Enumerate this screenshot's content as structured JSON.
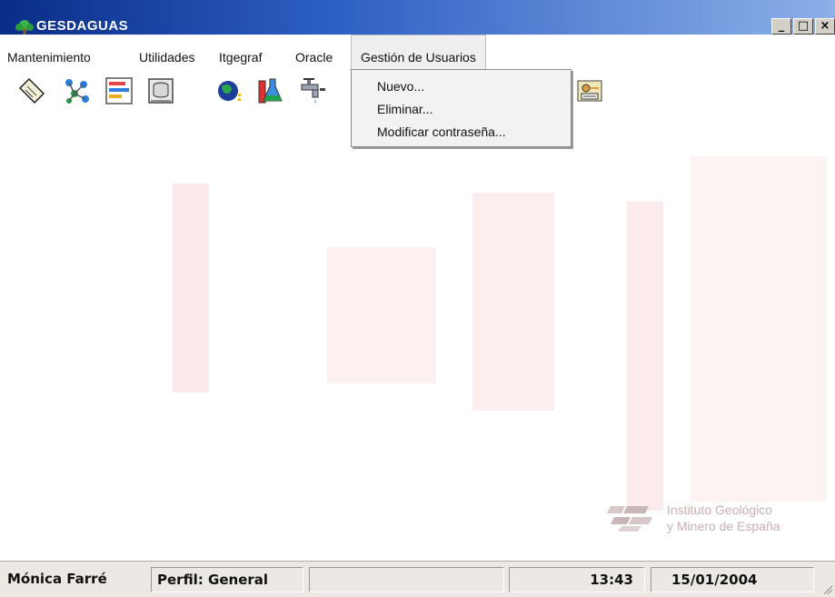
{
  "window": {
    "title": "GESDAGUAS",
    "icon": "app-tree-icon",
    "controls": [
      "_",
      "□",
      "×"
    ]
  },
  "menu": {
    "items": [
      "Mantenimiento",
      "Utilidades",
      "Itgegraf",
      "Oracle",
      "Gestión de Usuarios"
    ],
    "open_menu": "Gestión de Usuarios",
    "dropdown": [
      "Nuevo...",
      "Eliminar...",
      "Modificar contraseña..."
    ]
  },
  "toolbar": {
    "icons": [
      "document-icon",
      "network-icon",
      "chart-icon",
      "database-icon",
      "globe-icon",
      "lab-flask-icon",
      "water-tap-icon",
      "user-keys-icon"
    ]
  },
  "logo": {
    "line1": "Instituto Geológico",
    "line2": "y Minero de España"
  },
  "status": {
    "user": "Mónica Farré",
    "profile": "Perfil: General",
    "time": "13:43",
    "date": "15/01/2004"
  },
  "colors": {
    "title_gradient_start": "#0a2d87",
    "title_gradient_end": "#8eb0e8",
    "watermark": "#fbe9ea",
    "logo_text": "#c9b0b0"
  }
}
